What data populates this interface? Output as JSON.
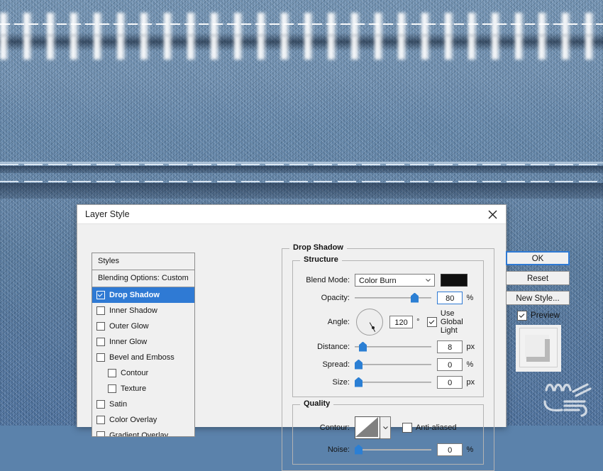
{
  "background": {
    "name": "denim-jeans-texture",
    "base_color": "#5d83ab",
    "watermark_alt": "persian-script-watermark"
  },
  "dialog": {
    "title": "Layer Style",
    "close_icon": "close-icon",
    "style_list": {
      "header": "Styles",
      "blending_options": "Blending Options: Custom",
      "items": [
        {
          "label": "Drop Shadow",
          "checked": true,
          "selected": true,
          "indent": false
        },
        {
          "label": "Inner Shadow",
          "checked": false,
          "selected": false,
          "indent": false
        },
        {
          "label": "Outer Glow",
          "checked": false,
          "selected": false,
          "indent": false
        },
        {
          "label": "Inner Glow",
          "checked": false,
          "selected": false,
          "indent": false
        },
        {
          "label": "Bevel and Emboss",
          "checked": false,
          "selected": false,
          "indent": false
        },
        {
          "label": "Contour",
          "checked": false,
          "selected": false,
          "indent": true
        },
        {
          "label": "Texture",
          "checked": false,
          "selected": false,
          "indent": true
        },
        {
          "label": "Satin",
          "checked": false,
          "selected": false,
          "indent": false
        },
        {
          "label": "Color Overlay",
          "checked": false,
          "selected": false,
          "indent": false
        },
        {
          "label": "Gradient Overlay",
          "checked": false,
          "selected": false,
          "indent": false
        }
      ]
    },
    "panel": {
      "title": "Drop Shadow",
      "structure": {
        "title": "Structure",
        "blend_mode_label": "Blend Mode:",
        "blend_mode_value": "Color Burn",
        "shadow_color": "#0f0f0f",
        "opacity_label": "Opacity:",
        "opacity_value": "80",
        "opacity_unit": "%",
        "opacity_pct": 80,
        "angle_label": "Angle:",
        "angle_value": "120",
        "angle_unit": "°",
        "use_global_light_label": "Use Global Light",
        "use_global_light_checked": true,
        "distance_label": "Distance:",
        "distance_value": "8",
        "distance_unit": "px",
        "distance_pct": 6,
        "spread_label": "Spread:",
        "spread_value": "0",
        "spread_unit": "%",
        "spread_pct": 0,
        "size_label": "Size:",
        "size_value": "0",
        "size_unit": "px",
        "size_pct": 0
      },
      "quality": {
        "title": "Quality",
        "contour_label": "Contour:",
        "contour_icon": "linear-contour-swatch",
        "anti_aliased_label": "Anti-aliased",
        "anti_aliased_checked": false,
        "noise_label": "Noise:",
        "noise_value": "0",
        "noise_unit": "%",
        "noise_pct": 0
      }
    },
    "buttons": {
      "ok": "OK",
      "reset": "Reset",
      "new_style": "New Style...",
      "preview_label": "Preview",
      "preview_checked": true
    }
  },
  "colors": {
    "accent": "#2f7ad4",
    "dialog_bg": "#f0f0f0",
    "selected_row": "#2f7ad4"
  }
}
